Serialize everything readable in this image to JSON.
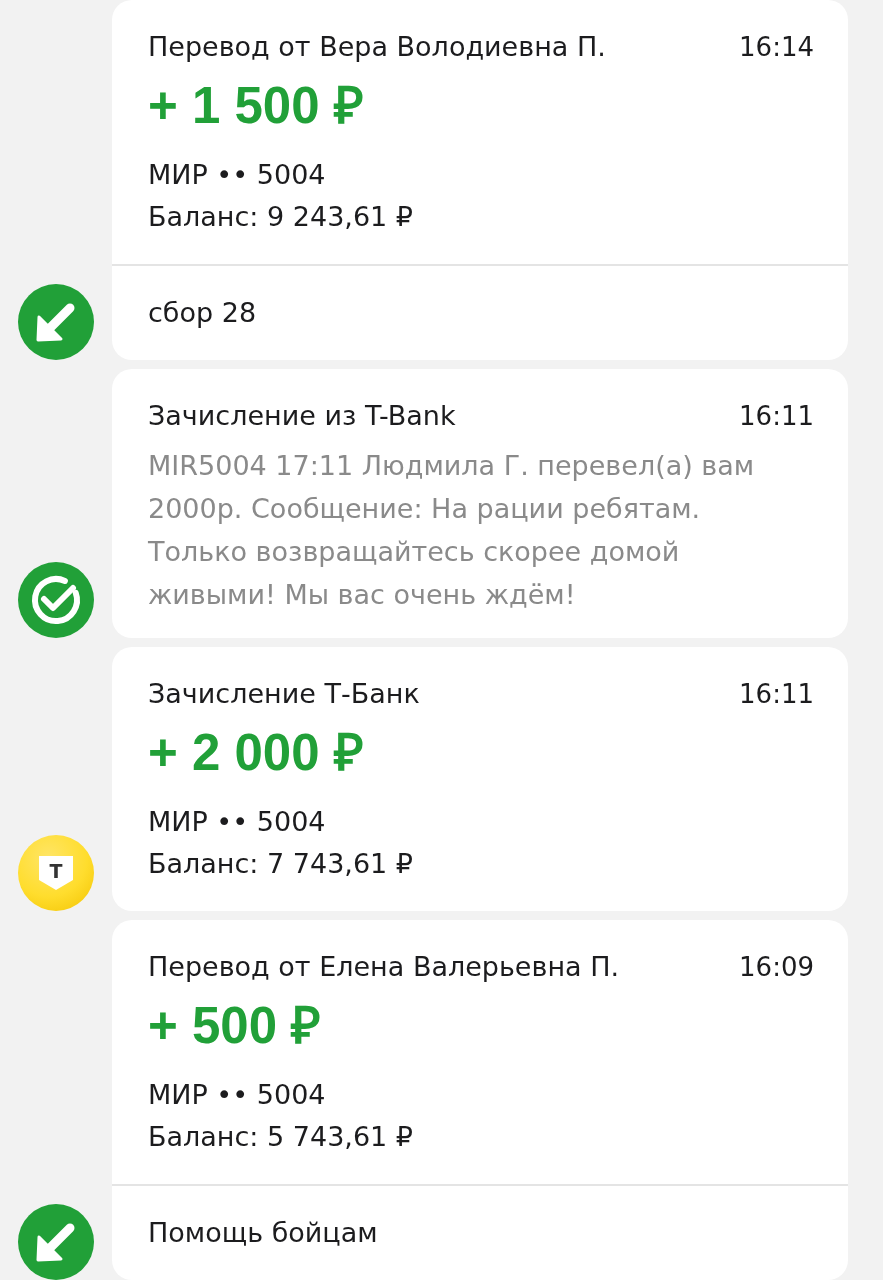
{
  "messages": [
    {
      "avatar": {
        "kind": "incoming-arrow"
      },
      "kind": "transfer",
      "title": "Перевод от Вера Володиевна П.",
      "time": "16:14",
      "amount": "+ 1 500 ₽",
      "card": "МИР •• 5004",
      "balance": "Баланс: 9 243,61 ₽",
      "comment": "сбор 28"
    },
    {
      "avatar": {
        "kind": "check-logo"
      },
      "kind": "sms",
      "title": "Зачисление из T-Bank",
      "time": "16:11",
      "body": "MIR5004 17:11 Людмила Г. перевел(а) вам 2000р. Сообщение: На рации ребятам. Только возвращайтесь скорее домой живыми! Мы вас очень ждём!"
    },
    {
      "avatar": {
        "kind": "shield-logo",
        "letter": "Т"
      },
      "kind": "transfer",
      "title": "Зачисление Т-Банк",
      "time": "16:11",
      "amount": "+ 2 000 ₽",
      "card": "МИР •• 5004",
      "balance": "Баланс: 7 743,61 ₽"
    },
    {
      "avatar": {
        "kind": "incoming-arrow"
      },
      "kind": "transfer",
      "title": "Перевод от Елена Валерьевна П.",
      "time": "16:09",
      "amount": "+ 500 ₽",
      "card": "МИР •• 5004",
      "balance": "Баланс: 5 743,61 ₽",
      "comment": "Помощь бойцам"
    }
  ]
}
